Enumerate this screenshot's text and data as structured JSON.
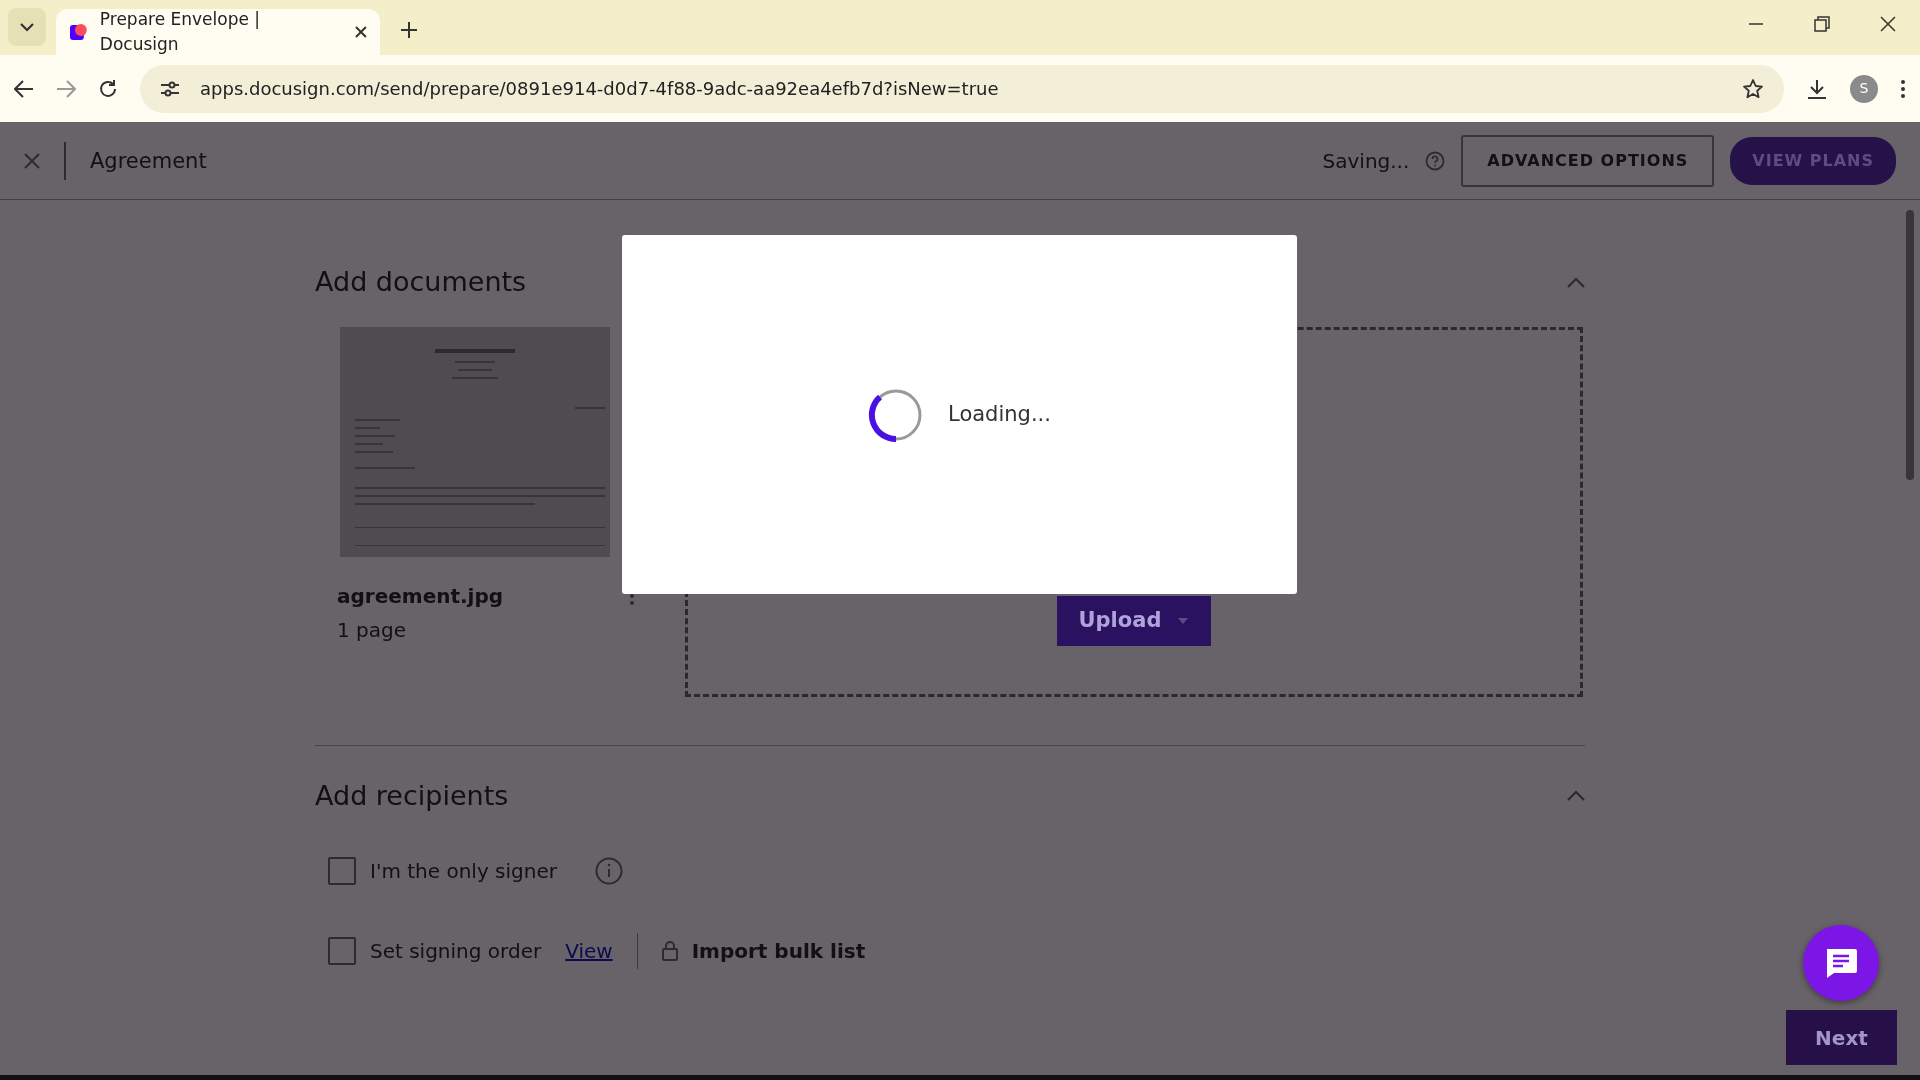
{
  "browser": {
    "tabs": [
      {
        "title": "Prepare Envelope | Docusign",
        "selected": true
      }
    ],
    "url": "apps.docusign.com/send/prepare/0891e914-d0d7-4f88-9adc-aa92ea4efb7d?isNew=true",
    "profile_initial": "S"
  },
  "header": {
    "title": "Agreement",
    "status": "Saving...",
    "buttons": [
      {
        "label": "ADVANCED OPTIONS",
        "kind": "outline"
      },
      {
        "label": "VIEW PLANS",
        "kind": "primary"
      }
    ]
  },
  "documents": {
    "title": "Add documents",
    "expanded": true,
    "files": [
      {
        "name": "agreement.jpg",
        "pages": "1 page"
      }
    ],
    "upload": "Upload"
  },
  "recipients": {
    "title": "Add recipients",
    "expanded": true,
    "options": [
      {
        "label": "I'm the only signer",
        "checked": false,
        "info": true
      },
      {
        "label": "Set signing order",
        "checked": false,
        "info": false
      }
    ],
    "view_link": "View",
    "import_label": "Import bulk list"
  },
  "footer": {
    "next": "Next"
  },
  "modal": {
    "message": "Loading..."
  }
}
